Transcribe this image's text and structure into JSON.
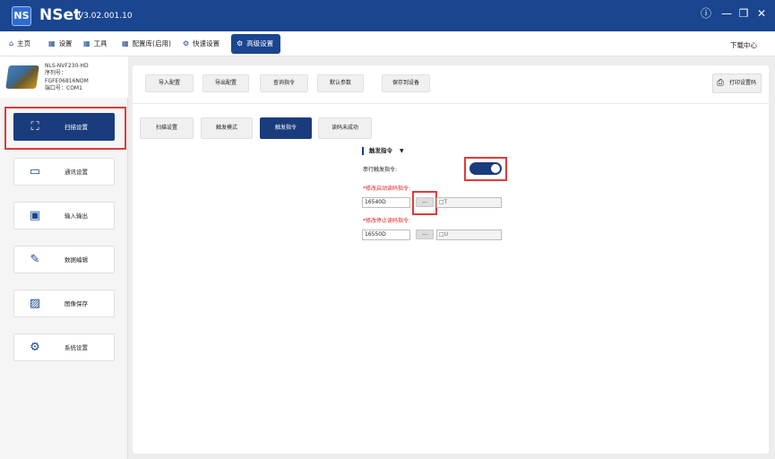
{
  "app": {
    "name": "NSet",
    "version": "V3.02.001.10",
    "logo_text": "NS"
  },
  "window_controls": {
    "info": "ⓘ",
    "minimize": "—",
    "restore": "❐",
    "close": "✕"
  },
  "menu": {
    "items": [
      {
        "label": "主页",
        "icon": "home-icon"
      },
      {
        "label": "设置",
        "icon": "grid-icon"
      },
      {
        "label": "工具",
        "icon": "grid-icon"
      },
      {
        "label": "配置库(启用)",
        "icon": "grid-icon"
      },
      {
        "label": "快速设置",
        "icon": "gear-icon"
      },
      {
        "label": "高级设置",
        "icon": "gear-icon"
      }
    ],
    "download_center": "下载中心"
  },
  "device": {
    "model": "NLS-NVF230-HD",
    "serial_label": "序列号：",
    "serial_value": "FGFE06816NOM",
    "port_label": "端口号：COM1"
  },
  "sidebar": {
    "items": [
      {
        "label": "扫描设置",
        "icon": "scan-icon"
      },
      {
        "label": "通讯设置",
        "icon": "devices-icon"
      },
      {
        "label": "输入输出",
        "icon": "monitor-icon"
      },
      {
        "label": "数据编辑",
        "icon": "edit-icon"
      },
      {
        "label": "图像保存",
        "icon": "image-icon"
      },
      {
        "label": "系统设置",
        "icon": "system-icon"
      }
    ]
  },
  "toolbar": {
    "import": "导入配置",
    "export": "导出配置",
    "query": "查询指令",
    "default": "默认参数",
    "save_device": "保存到设备",
    "print": "打印设置码"
  },
  "tabs": [
    {
      "label": "扫描设置"
    },
    {
      "label": "触发模式"
    },
    {
      "label": "触发指令"
    },
    {
      "label": "读码未成功"
    }
  ],
  "trigger": {
    "section_title": "触发指令",
    "caret": "▼",
    "serial_trigger_label": "串行触发指令:",
    "serial_trigger_on": true,
    "start_label": "*修改启动读码指令:",
    "start_code": "16540D",
    "start_ascii": "□T",
    "stop_label": "*修改停止读码指令:",
    "stop_code": "16550D",
    "stop_ascii": "□U",
    "dots": "..."
  }
}
